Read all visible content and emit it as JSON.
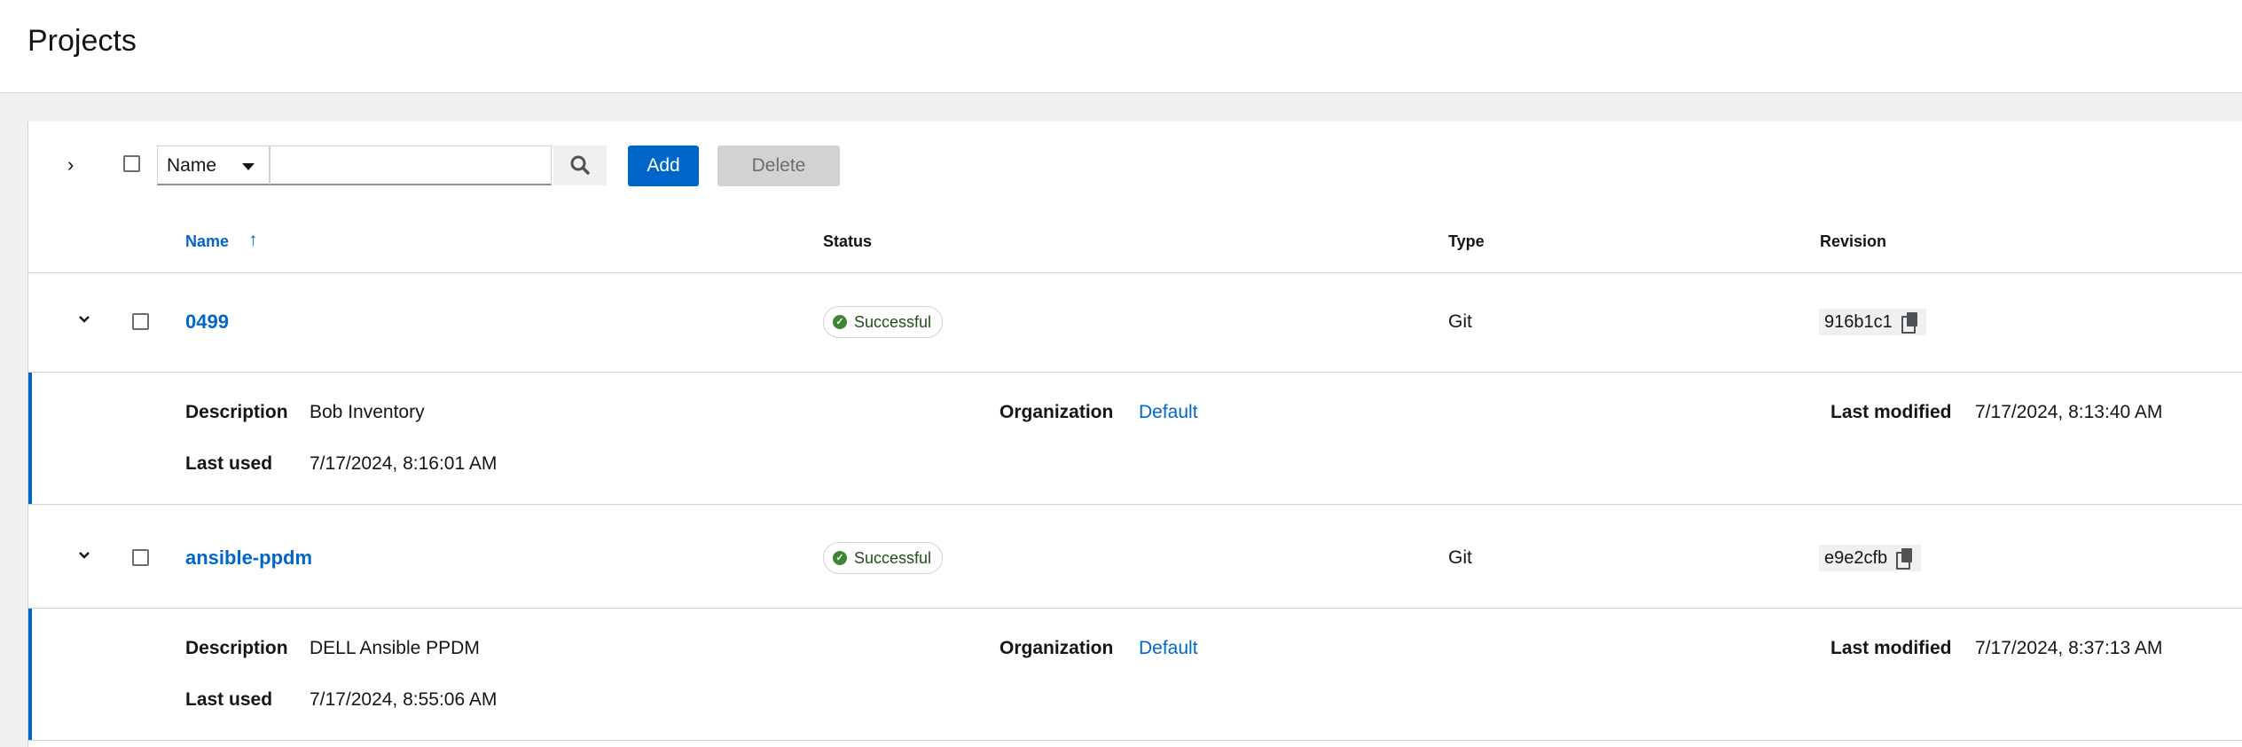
{
  "header": {
    "title": "Projects"
  },
  "toolbar": {
    "filter_field": "Name",
    "search_value": "",
    "add_label": "Add",
    "delete_label": "Delete"
  },
  "columns": {
    "name": "Name",
    "status": "Status",
    "type": "Type",
    "revision": "Revision"
  },
  "sort": {
    "column": "Name",
    "direction": "ascending"
  },
  "detail_labels": {
    "description": "Description",
    "organization": "Organization",
    "last_modified": "Last modified",
    "last_used": "Last used"
  },
  "rows": [
    {
      "name": "0499",
      "status": "Successful",
      "type": "Git",
      "revision": "916b1c1",
      "expanded": true,
      "description": "Bob Inventory",
      "organization": "Default",
      "last_modified": "7/17/2024, 8:13:40 AM",
      "last_used": "7/17/2024, 8:16:01 AM"
    },
    {
      "name": "ansible-ppdm",
      "status": "Successful",
      "type": "Git",
      "revision": "e9e2cfb",
      "expanded": true,
      "description": "DELL Ansible PPDM",
      "organization": "Default",
      "last_modified": "7/17/2024, 8:37:13 AM",
      "last_used": "7/17/2024, 8:55:06 AM"
    }
  ],
  "colors": {
    "accent": "#0066cc",
    "success": "#3e8635",
    "background": "#f0f0f0"
  }
}
